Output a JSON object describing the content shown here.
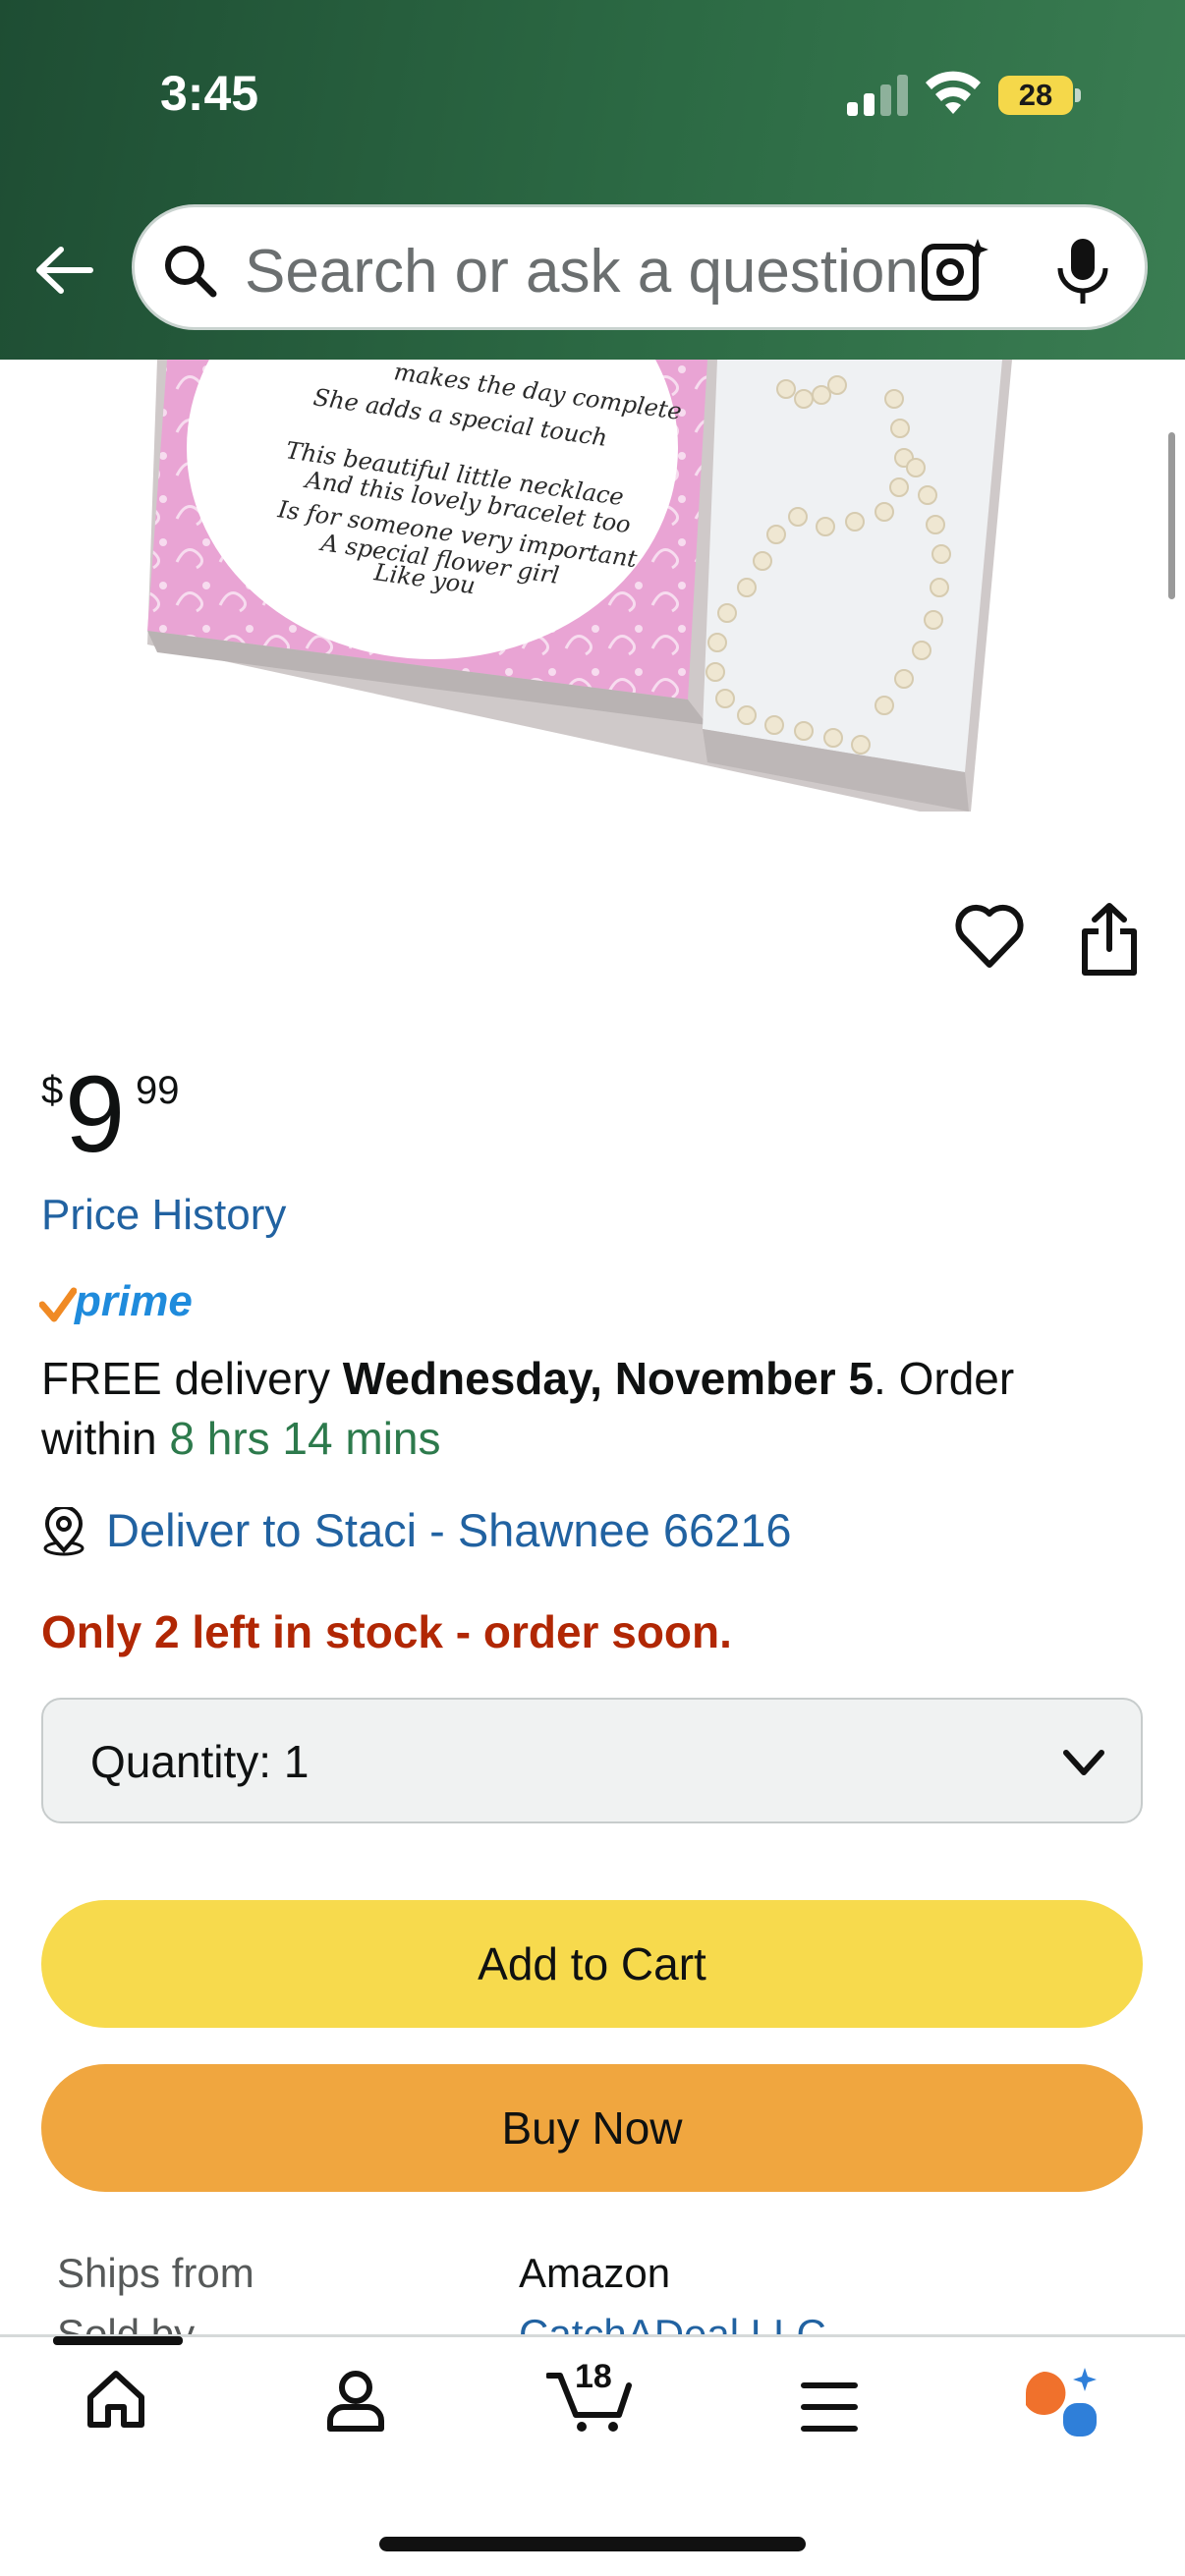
{
  "status_bar": {
    "time": "3:45",
    "battery": "28"
  },
  "search": {
    "placeholder": "Search or ask a question"
  },
  "product_image": {
    "poem_lines": [
      "makes the day complete",
      "She adds a special touch",
      "This beautiful little necklace",
      "And this lovely bracelet too",
      "Is for someone very important",
      "A special flower girl",
      "Like you"
    ]
  },
  "price": {
    "symbol": "$",
    "whole": "9",
    "fraction": "99"
  },
  "price_history": "Price History",
  "prime": {
    "label": "prime"
  },
  "delivery": {
    "prefix": "FREE delivery ",
    "date": "Wednesday, November 5",
    "middle": ". Order within ",
    "countdown": "8 hrs 14 mins"
  },
  "deliver_to": "Deliver to Staci - Shawnee 66216",
  "stock": "Only 2 left in stock - order soon.",
  "quantity": {
    "label": "Quantity:",
    "value": "1"
  },
  "buttons": {
    "add_to_cart": "Add to Cart",
    "buy_now": "Buy Now"
  },
  "details": {
    "ships_from_label": "Ships from",
    "ships_from_value": "Amazon",
    "sold_by_label": "Sold by",
    "sold_by_value": "CatchADeal LLC"
  },
  "bottom_nav": {
    "cart_count": "18"
  },
  "colors": {
    "header": "#2c6a44",
    "link": "#2162a1",
    "stock_alert": "#b12704",
    "add_to_cart": "#f7da4d",
    "buy_now": "#f0a63f",
    "countdown": "#2d7a4c"
  },
  "icons": [
    "back-arrow-icon",
    "search-icon",
    "camera-lens-icon",
    "microphone-icon",
    "heart-icon",
    "share-icon",
    "location-pin-icon",
    "chevron-down-icon",
    "home-icon",
    "account-icon",
    "cart-icon",
    "menu-icon",
    "rufus-ai-icon"
  ]
}
